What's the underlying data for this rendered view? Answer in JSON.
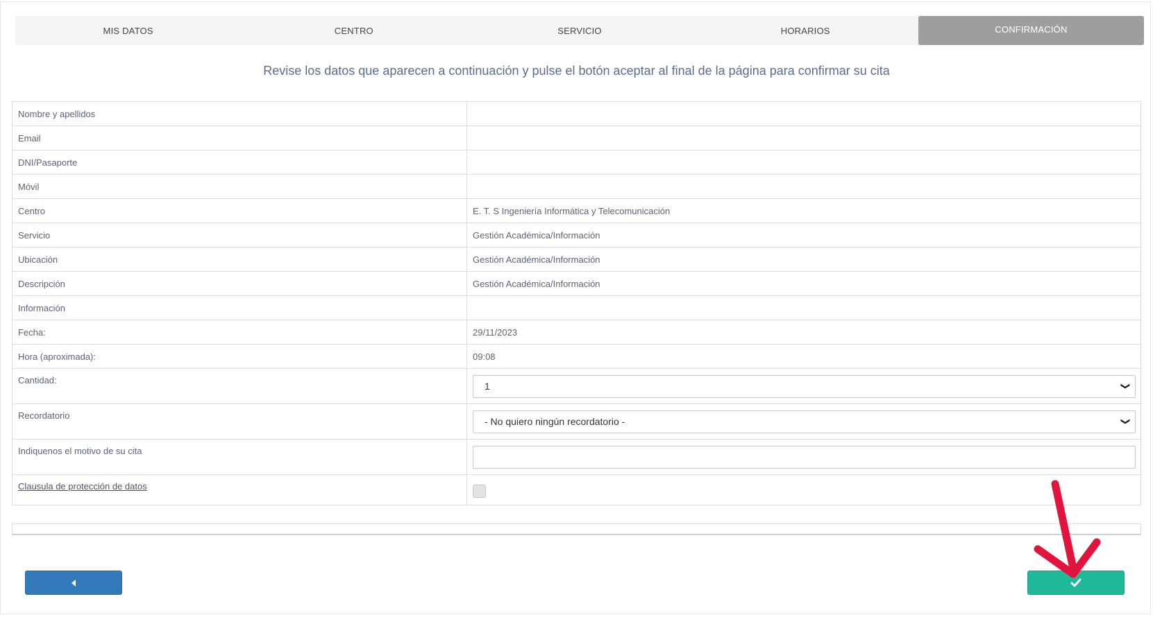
{
  "steps": [
    {
      "label": "MIS DATOS",
      "active": false
    },
    {
      "label": "CENTRO",
      "active": false
    },
    {
      "label": "SERVICIO",
      "active": false
    },
    {
      "label": "HORARIOS",
      "active": false
    },
    {
      "label": "CONFIRMACIÓN",
      "active": true
    }
  ],
  "intro": "Revise los datos que aparecen a continuación y pulse el botón aceptar al final de la página para confirmar su cita",
  "rows": {
    "nombre": {
      "label": "Nombre y apellidos",
      "value": ""
    },
    "email": {
      "label": "Email",
      "value": ""
    },
    "dni": {
      "label": "DNI/Pasaporte",
      "value": ""
    },
    "movil": {
      "label": "Móvil",
      "value": ""
    },
    "centro": {
      "label": "Centro",
      "value": "E. T. S Ingeniería Informática y Telecomunicación"
    },
    "servicio": {
      "label": "Servicio",
      "value": "Gestión Académica/Información"
    },
    "ubicacion": {
      "label": "Ubicación",
      "value": "Gestión Académica/Información"
    },
    "descripcion": {
      "label": "Descripción",
      "value": "Gestión Académica/Información"
    },
    "informacion": {
      "label": "Información",
      "value": ""
    },
    "fecha": {
      "label": "Fecha:",
      "value": "29/11/2023"
    },
    "hora": {
      "label": "Hora (aproximada):",
      "value": "09:08"
    }
  },
  "form": {
    "cantidad": {
      "label": "Cantidad:",
      "selected": "1"
    },
    "recordatorio": {
      "label": "Recordatorio",
      "selected": "- No quiero ningún recordatorio -"
    },
    "motivo": {
      "label": "Indiquenos el motivo de su cita",
      "value": ""
    },
    "clausula": {
      "label": "Clausula de protección de datos",
      "checked": false
    }
  },
  "buttons": {
    "back_icon": "caret-left-icon",
    "confirm_icon": "check-icon"
  },
  "colors": {
    "back": "#3379bb",
    "confirm": "#1fb899",
    "annotation_arrow": "#e0143c",
    "active_step": "#9e9e9e"
  }
}
